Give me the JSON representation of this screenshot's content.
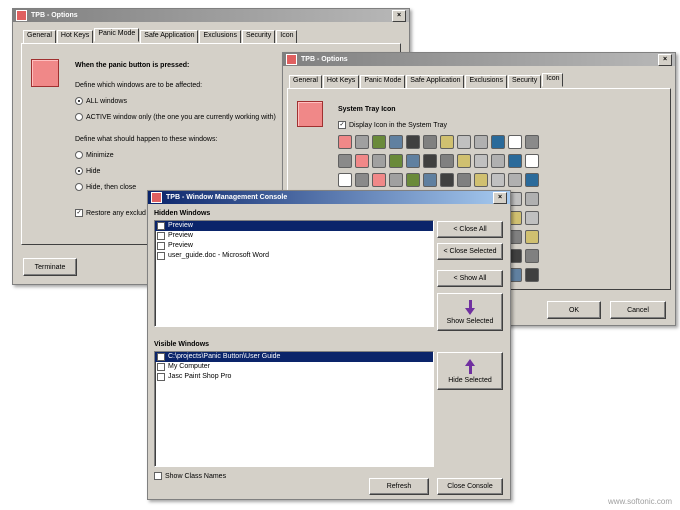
{
  "win1": {
    "title": "TPB - Options",
    "close": "×",
    "tabs": [
      "General",
      "Hot Keys",
      "Panic Mode",
      "Safe Application",
      "Exclusions",
      "Security",
      "Icon"
    ],
    "selected_tab": "Panic Mode",
    "heading": "When the panic button is pressed:",
    "define_windows": "Define which windows are to be affected:",
    "opt_all": "ALL windows",
    "opt_active": "ACTIVE window only (the one you are currently working with)",
    "define_happen": "Define what should happen to these windows:",
    "opt_minimize": "Minimize",
    "opt_hide": "Hide",
    "opt_hide_close": "Hide, then close",
    "restore": "Restore any exclud",
    "terminate": "Terminate"
  },
  "win2": {
    "title": "TPB - Options",
    "close": "×",
    "tabs": [
      "General",
      "Hot Keys",
      "Panic Mode",
      "Safe Application",
      "Exclusions",
      "Security",
      "Icon"
    ],
    "selected_tab": "Icon",
    "heading": "System Tray Icon",
    "display_icon": "Display Icon in the System Tray",
    "ok": "OK",
    "cancel": "Cancel"
  },
  "win3": {
    "title": "TPB - Window Management Console",
    "close": "×",
    "hidden_label": "Hidden Windows",
    "hidden_items": [
      "Preview",
      "Preview",
      "Preview",
      "user_guide.doc - Microsoft Word"
    ],
    "visible_label": "Visible Windows",
    "visible_items": [
      "C:\\projects\\Panic Button\\User Guide",
      "My Computer",
      "Jasc Paint Shop Pro"
    ],
    "close_all": "< Close All",
    "close_selected": "< Close Selected",
    "show_all": "< Show All",
    "show_selected": "Show Selected",
    "hide_selected": "Hide Selected",
    "show_class_names": "Show Class Names",
    "refresh": "Refresh",
    "close_console": "Close Console"
  },
  "watermark": "www.softonic.com"
}
